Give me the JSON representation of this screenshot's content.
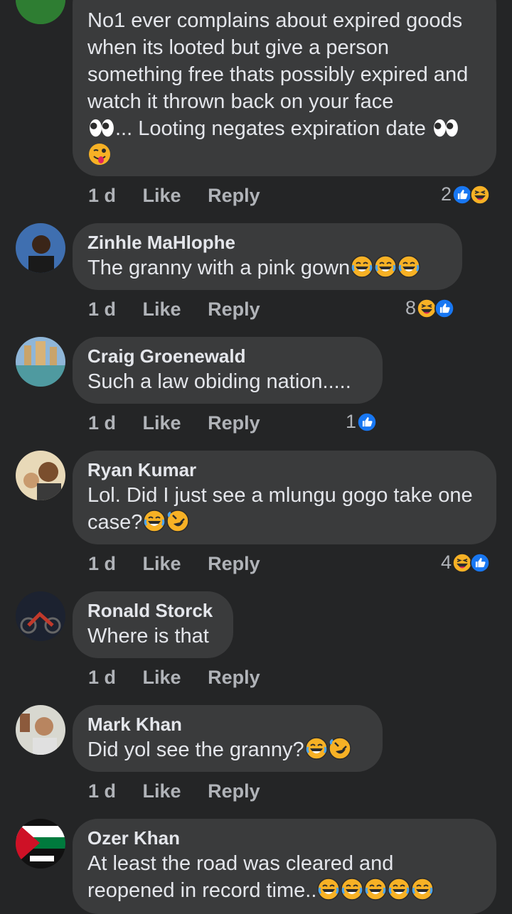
{
  "comments": [
    {
      "author": "",
      "text": "No1 ever complains about expired goods when its looted but give a person something free thats possibly expired and watch it thrown back on your face",
      "text2": "... Looting negates expiration date",
      "time": "1 d",
      "like": "Like",
      "reply": "Reply",
      "reaction_count": "2"
    },
    {
      "author": "Zinhle MaHlophe",
      "text": "The granny with a pink gown",
      "time": "1 d",
      "like": "Like",
      "reply": "Reply",
      "reaction_count": "8"
    },
    {
      "author": "Craig Groenewald",
      "text": "Such a law obiding nation.....",
      "time": "1 d",
      "like": "Like",
      "reply": "Reply",
      "reaction_count": "1"
    },
    {
      "author": "Ryan Kumar",
      "text": "Lol. Did I just see a mlungu gogo take one case?",
      "time": "1 d",
      "like": "Like",
      "reply": "Reply",
      "reaction_count": "4"
    },
    {
      "author": "Ronald Storck",
      "text": "Where is that",
      "time": "1 d",
      "like": "Like",
      "reply": "Reply"
    },
    {
      "author": "Mark Khan",
      "text": "Did yol see the granny?",
      "time": "1 d",
      "like": "Like",
      "reply": "Reply"
    },
    {
      "author": "Ozer Khan",
      "text": "At least the road was cleared and reopened in record time..",
      "time": "1 d",
      "like": "Like",
      "reply": "Reply"
    }
  ],
  "colors": {
    "background": "#242526",
    "bubble": "#3a3b3c",
    "primary_text": "#e4e6eb",
    "secondary_text": "#b0b3b8",
    "like_blue": "#1877f2",
    "haha_yellow": "#f7b125"
  }
}
